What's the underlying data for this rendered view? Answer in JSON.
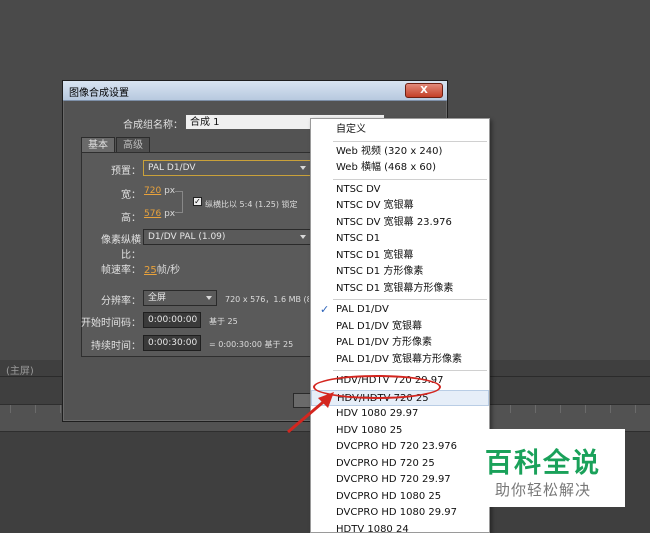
{
  "background": {
    "label": "(主屏)"
  },
  "dialog": {
    "title": "图像合成设置",
    "close_label": "X",
    "comp_name_label": "合成组名称：",
    "comp_name_value": "合成 1",
    "tabs": [
      {
        "label": "基本",
        "active": true
      },
      {
        "label": "高级",
        "active": false
      }
    ],
    "preset_label": "预置：",
    "preset_value": "PAL D1/DV",
    "width_label": "宽：",
    "width_value": "720",
    "width_unit": "px",
    "lock_aspect_label": "纵横比以 5:4 (1.25) 锁定",
    "height_label": "高：",
    "height_value": "576",
    "height_unit": "px",
    "pixel_aspect_label": "像素纵横比：",
    "pixel_aspect_value": "D1/DV PAL (1.09)",
    "frame_rate_label": "帧速率：",
    "frame_rate_value": "25",
    "frame_rate_unit": "帧/秒",
    "resolution_label": "分辨率：",
    "resolution_value": "全屏",
    "resolution_info": "720 x 576，1.6 MB (8bpc/帧)",
    "start_tc_label": "开始时间码：",
    "start_tc_value": "0:00:00:00",
    "start_tc_note": "基于 25",
    "duration_label": "持续时间：",
    "duration_value": "0:00:30:00",
    "duration_note": "= 0:00:30:00  基于 25"
  },
  "menu": {
    "selected": "PAL D1/DV",
    "highlighted": "HDV/HDTV 720 25",
    "items": [
      "自定义",
      "Web 视频 (320 x 240)",
      "Web 横幅 (468 x 60)",
      "NTSC DV",
      "NTSC DV 宽银幕",
      "NTSC DV 宽银幕 23.976",
      "NTSC D1",
      "NTSC D1 宽银幕",
      "NTSC D1 方形像素",
      "NTSC D1 宽银幕方形像素",
      "PAL D1/DV",
      "PAL D1/DV 宽银幕",
      "PAL D1/DV 方形像素",
      "PAL D1/DV 宽银幕方形像素",
      "HDV/HDTV 720 29.97",
      "HDV/HDTV 720 25",
      "HDV 1080 29.97",
      "HDV 1080 25",
      "DVCPRO HD 720 23.976",
      "DVCPRO HD 720 25",
      "DVCPRO HD 720 29.97",
      "DVCPRO HD 1080 25",
      "DVCPRO HD 1080 29.97",
      "HDTV 1080 24"
    ]
  },
  "watermark": {
    "title": "百科全说",
    "subtitle": "助你轻松解决"
  },
  "colors": {
    "annotation_red": "#d4261f",
    "watermark_green": "#1aa15a",
    "accent_orange": "#e8a23c"
  }
}
